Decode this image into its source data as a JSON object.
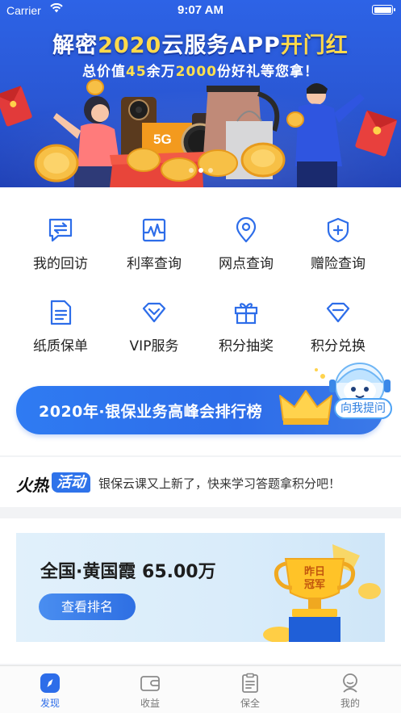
{
  "status_bar": {
    "carrier": "Carrier",
    "time": "9:07 AM"
  },
  "banner": {
    "title_prefix": "解密",
    "title_highlight": "2020",
    "title_middle": "云服务APP",
    "title_suffix": "开门红",
    "sub_prefix": "总价值",
    "sub_num1": "45",
    "sub_mid": "余万",
    "sub_num2": "2000",
    "sub_suffix": "份好礼等您拿！",
    "phone_label": "5G",
    "slide_count": 3,
    "active_slide": 1
  },
  "quick_actions": [
    {
      "label": "我的回访",
      "icon": "chat-swap-icon"
    },
    {
      "label": "利率查询",
      "icon": "line-chart-icon"
    },
    {
      "label": "网点查询",
      "icon": "location-pin-icon"
    },
    {
      "label": "赠险查询",
      "icon": "shield-plus-icon"
    },
    {
      "label": "纸质保单",
      "icon": "document-icon"
    },
    {
      "label": "VIP服务",
      "icon": "vip-diamond-icon"
    },
    {
      "label": "积分抽奖",
      "icon": "gift-icon"
    },
    {
      "label": "积分兑换",
      "icon": "exchange-gem-icon"
    }
  ],
  "ranking_banner": {
    "label": "2020年·银保业务高峰会排行榜"
  },
  "assistant": {
    "label": "向我提问"
  },
  "hot_activity": {
    "tag_fire": "火热",
    "tag_activity": "活动",
    "notice": "银保云课又上新了，快来学习答题拿积分吧！"
  },
  "rank_card": {
    "name": "全国·黄国霞 65.00万",
    "button": "查看排名",
    "trophy_text_line1": "昨日",
    "trophy_text_line2": "冠军"
  },
  "tabbar": [
    {
      "label": "发现",
      "icon": "compass-icon",
      "active": true
    },
    {
      "label": "收益",
      "icon": "wallet-icon",
      "active": false
    },
    {
      "label": "保全",
      "icon": "clipboard-icon",
      "active": false
    },
    {
      "label": "我的",
      "icon": "profile-icon",
      "active": false
    }
  ],
  "colors": {
    "primary": "#2d6de9",
    "banner_bg": "#2a57d4",
    "highlight": "#ffd94a"
  }
}
